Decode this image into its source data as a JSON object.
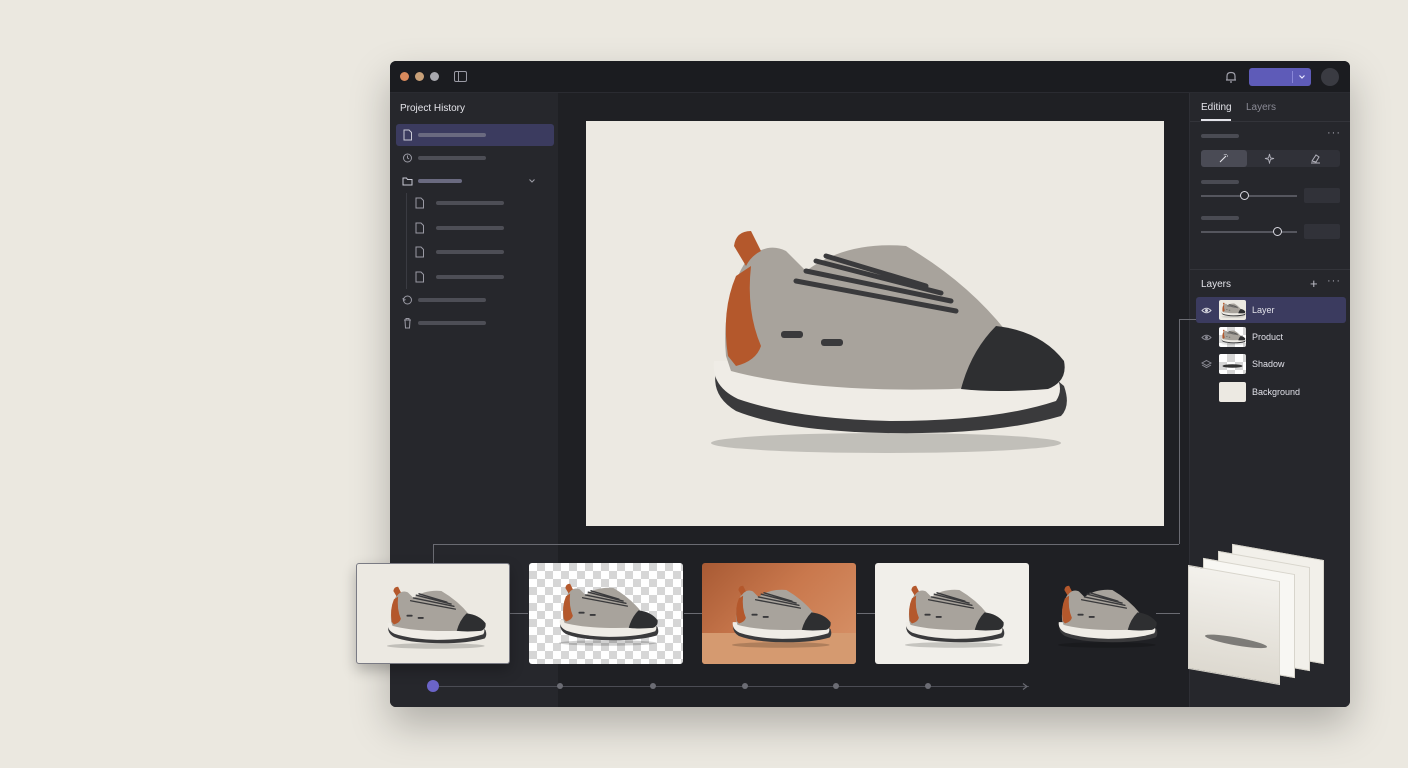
{
  "left_panel": {
    "title": "Project History"
  },
  "right_panel": {
    "tabs": [
      {
        "label": "Editing",
        "active": true
      },
      {
        "label": "Layers",
        "active": false
      }
    ],
    "sliders": [
      {
        "value": 0.45
      },
      {
        "value": 0.8
      }
    ]
  },
  "layers": {
    "title": "Layers",
    "items": [
      {
        "name": "Layer",
        "icon": "eye-icon",
        "active": true
      },
      {
        "name": "Product",
        "icon": "eye-icon",
        "active": false
      },
      {
        "name": "Shadow",
        "icon": "stack-icon",
        "active": false
      },
      {
        "name": "Background",
        "icon": "",
        "active": false
      }
    ]
  },
  "filmstrip": {
    "frames": [
      {
        "background": "cream",
        "selected": true
      },
      {
        "background": "transparent",
        "selected": false
      },
      {
        "background": "orange-studio",
        "selected": false
      },
      {
        "background": "white",
        "selected": false
      },
      {
        "background": "cutout",
        "selected": false
      }
    ]
  },
  "colors": {
    "accent": "#5e5bb8",
    "window_bg": "#1e1f24",
    "panel_bg": "#26272c",
    "canvas_bg": "#ece9e2",
    "page_bg": "#ebe8e0"
  }
}
